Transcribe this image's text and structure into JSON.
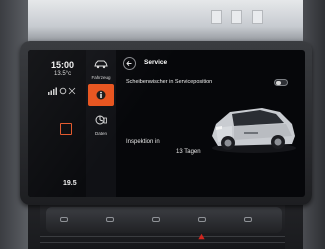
{
  "status_bar": {
    "time": "15:00",
    "outside_temperature": "13.5°c",
    "cabin_temperature": "19.5"
  },
  "nav": {
    "items": [
      {
        "label": "Fahrzeug",
        "icon": "car-icon",
        "active": false
      },
      {
        "label": "",
        "icon": "info-icon",
        "active": true
      },
      {
        "label": "Daten",
        "icon": "data-icon",
        "active": false
      }
    ]
  },
  "header": {
    "title": "Service",
    "back_icon": "arrow-left-icon"
  },
  "settings": {
    "wiper_service_position": {
      "label": "Scheibenwischer in Serviceposition",
      "enabled": false
    }
  },
  "inspection": {
    "label": "Inspektion in",
    "value": "13 Tagen"
  },
  "colors": {
    "accent": "#e8541e",
    "screen_background": "#06070a",
    "text": "#f2f2f2"
  }
}
